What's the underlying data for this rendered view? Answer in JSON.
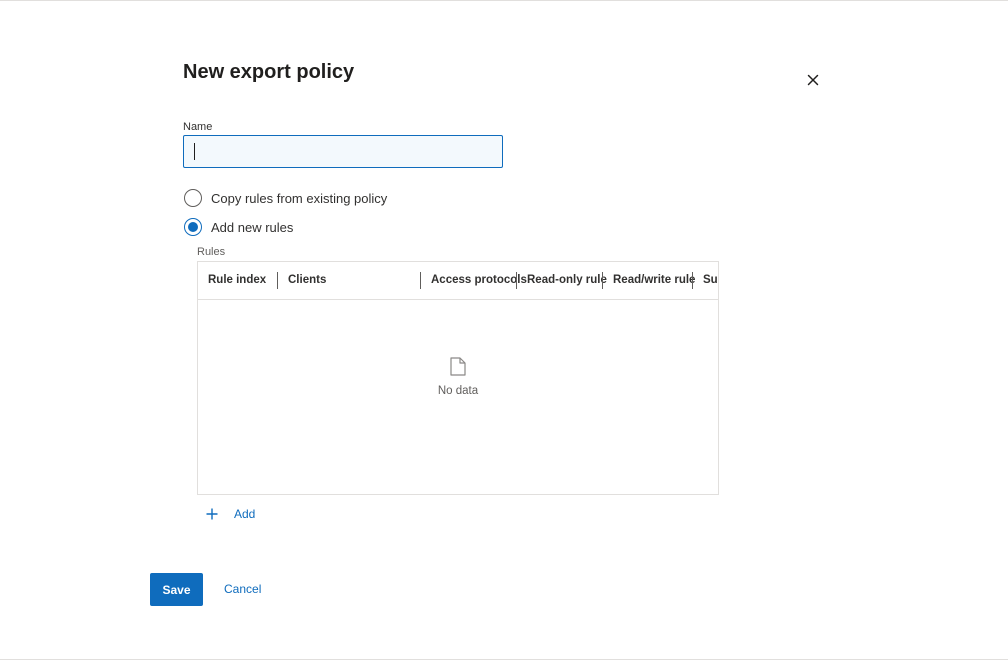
{
  "dialog": {
    "title": "New export policy",
    "close_icon": "close-icon"
  },
  "name_field": {
    "label": "Name",
    "value": "",
    "placeholder": ""
  },
  "rule_source": {
    "options": [
      {
        "label": "Copy rules from existing policy",
        "checked": false
      },
      {
        "label": "Add new rules",
        "checked": true
      }
    ]
  },
  "rules": {
    "label": "Rules",
    "columns": [
      "Rule index",
      "Clients",
      "Access protocols",
      "Read-only rule",
      "Read/write rule",
      "Superuser"
    ],
    "rows": [],
    "empty_icon": "document-icon",
    "empty_text": "No data",
    "add_icon": "plus-icon",
    "add_label": "Add"
  },
  "footer": {
    "save_label": "Save",
    "cancel_label": "Cancel"
  },
  "colors": {
    "accent": "#0f6cbd",
    "input_background": "#f3f9fd",
    "border": "#e1dfdd"
  }
}
